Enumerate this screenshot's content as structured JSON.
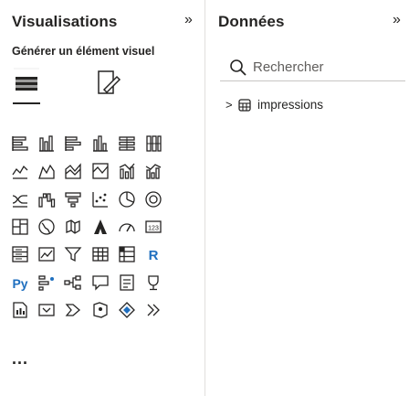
{
  "visualisations": {
    "title": "Visualisations",
    "collapse_icon": "»",
    "subtitle": "Générer un élément visuel",
    "more_label": "...",
    "icons": [
      [
        "stacked-bar-icon",
        "clustered-bar-icon",
        "stacked-column-icon",
        "clustered-column-icon",
        "100-bar-icon",
        "100-column-icon"
      ],
      [
        "line-chart-icon",
        "area-chart-icon",
        "stacked-area-icon",
        "100-area-icon",
        "line-column-icon",
        "line-clustered-column-icon"
      ],
      [
        "ribbon-chart-icon",
        "waterfall-icon",
        "funnel-icon",
        "scatter-icon",
        "pie-icon",
        "donut-icon"
      ],
      [
        "treemap-icon",
        "map-icon",
        "filled-map-icon",
        "azure-map-icon",
        "gauge-icon",
        "card-icon"
      ],
      [
        "multi-row-card-icon",
        "kpi-icon",
        "slicer-icon",
        "table-icon",
        "matrix-icon",
        "r-script-icon"
      ],
      [
        "python-icon",
        "key-influencers-icon",
        "decomposition-tree-icon",
        "qna-icon",
        "narrative-icon",
        "goals-icon"
      ],
      [
        "paginated-report-icon",
        "power-apps-icon",
        "power-automate-icon",
        "arcgis-icon",
        "diamond-icon",
        "chevrons-icon"
      ]
    ]
  },
  "data_pane": {
    "title": "Données",
    "collapse_icon": "»",
    "search_placeholder": "Rechercher",
    "tree_chevron": ">",
    "table_name": "impressions"
  }
}
